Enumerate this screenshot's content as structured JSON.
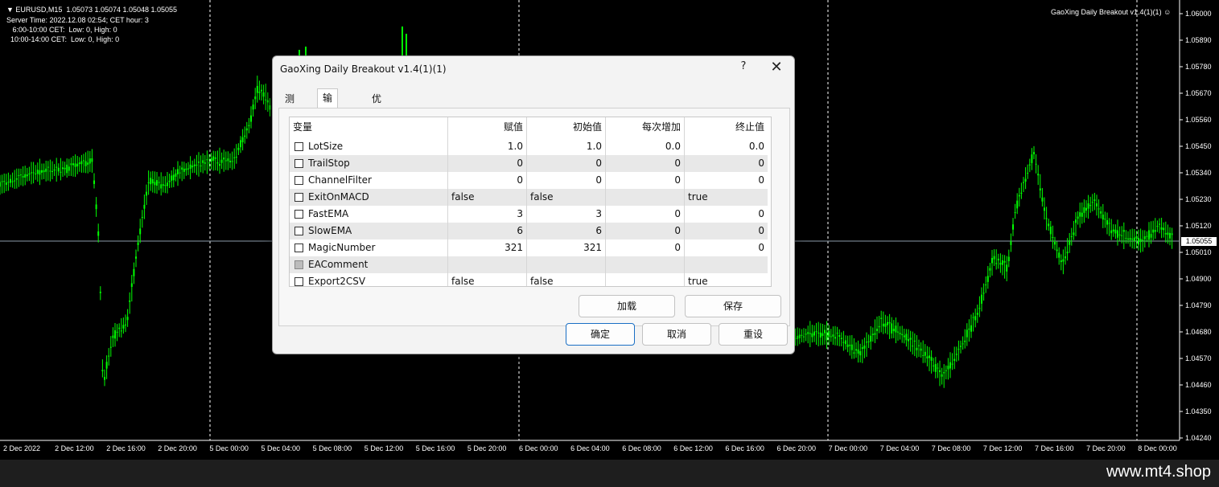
{
  "chart": {
    "header_lines": [
      "▼ EURUSD,M15  1.05073 1.05074 1.05048 1.05055",
      "Server Time: 2022.12.08 02:54; CET hour: 3",
      "   6:00-10:00 CET:  Low: 0, High: 0",
      "  10:00-14:00 CET:  Low: 0, High: 0"
    ],
    "ea_label": "GaoXing Daily Breakout v1.4(1)(1) ☺",
    "price_labels": [
      "1.06000",
      "1.05890",
      "1.05780",
      "1.05670",
      "1.05560",
      "1.05450",
      "1.05340",
      "1.05230",
      "1.05120",
      "1.05010",
      "1.04900",
      "1.04790",
      "1.04680",
      "1.04570",
      "1.04460",
      "1.04350",
      "1.04240"
    ],
    "current_price": "1.05055",
    "time_labels": [
      "2 Dec 2022",
      "2 Dec 12:00",
      "2 Dec 16:00",
      "2 Dec 20:00",
      "5 Dec 00:00",
      "5 Dec 04:00",
      "5 Dec 08:00",
      "5 Dec 12:00",
      "5 Dec 16:00",
      "5 Dec 20:00",
      "6 Dec 00:00",
      "6 Dec 04:00",
      "6 Dec 08:00",
      "6 Dec 12:00",
      "6 Dec 16:00",
      "6 Dec 20:00",
      "7 Dec 00:00",
      "7 Dec 04:00",
      "7 Dec 08:00",
      "7 Dec 12:00",
      "7 Dec 16:00",
      "7 Dec 20:00",
      "8 Dec 00:00"
    ],
    "candle_color": "#00ff00",
    "grid_color": "#ffffff"
  },
  "watermark": "www.mt4.shop",
  "dialog": {
    "title": "GaoXing Daily Breakout v1.4(1)(1)",
    "help": "?",
    "close": "✕",
    "tabs": [
      "测试",
      "输入参数",
      "优化"
    ],
    "active_tab": 1,
    "columns": [
      "变量",
      "赋值",
      "初始值",
      "每次增加",
      "终止值"
    ],
    "rows": [
      {
        "name": "LotSize",
        "value": "1.0",
        "start": "1.0",
        "step": "0.0",
        "stop": "0.0",
        "numeric": true,
        "disabled": false
      },
      {
        "name": "TrailStop",
        "value": "0",
        "start": "0",
        "step": "0",
        "stop": "0",
        "numeric": true,
        "disabled": false
      },
      {
        "name": "ChannelFilter",
        "value": "0",
        "start": "0",
        "step": "0",
        "stop": "0",
        "numeric": true,
        "disabled": false
      },
      {
        "name": "ExitOnMACD",
        "value": "false",
        "start": "false",
        "step": "",
        "stop": "true",
        "numeric": false,
        "disabled": false
      },
      {
        "name": "FastEMA",
        "value": "3",
        "start": "3",
        "step": "0",
        "stop": "0",
        "numeric": true,
        "disabled": false
      },
      {
        "name": "SlowEMA",
        "value": "6",
        "start": "6",
        "step": "0",
        "stop": "0",
        "numeric": true,
        "disabled": false
      },
      {
        "name": "MagicNumber",
        "value": "321",
        "start": "321",
        "step": "0",
        "stop": "0",
        "numeric": true,
        "disabled": false
      },
      {
        "name": "EAComment",
        "value": "",
        "start": "",
        "step": "",
        "stop": "",
        "numeric": false,
        "disabled": true
      },
      {
        "name": "Export2CSV",
        "value": "false",
        "start": "false",
        "step": "",
        "stop": "true",
        "numeric": false,
        "disabled": false
      }
    ],
    "buttons": {
      "load": "加载",
      "save": "保存",
      "ok": "确定",
      "cancel": "取消",
      "reset": "重设"
    }
  }
}
